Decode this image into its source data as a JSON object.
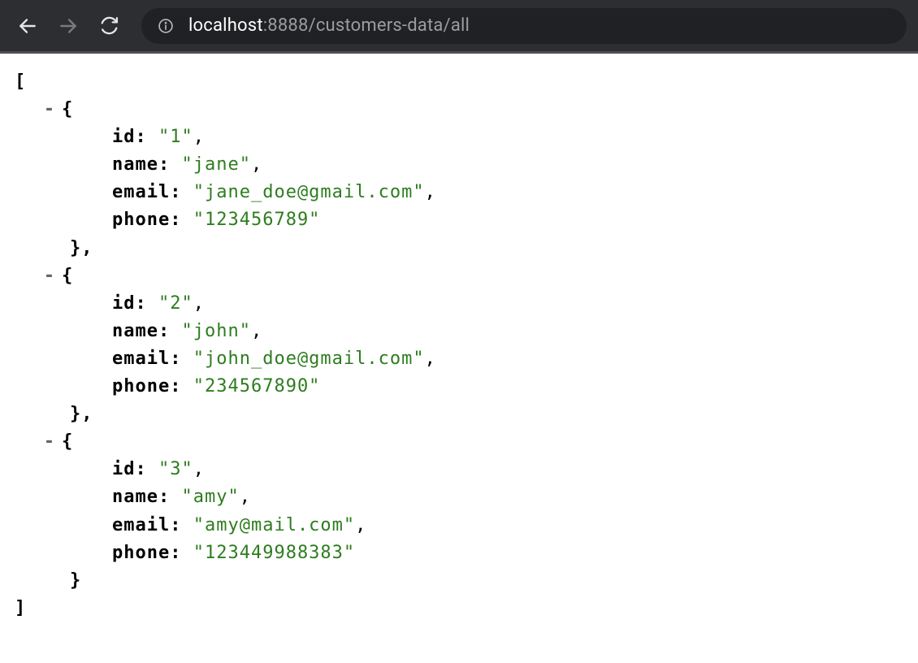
{
  "browser": {
    "url_host": "localhost",
    "url_port": ":8888",
    "url_path": "/customers-data/all"
  },
  "json": {
    "open_bracket": "[",
    "close_bracket": "]",
    "open_brace": "{",
    "close_brace": "}",
    "close_brace_comma": "},",
    "dash": "-",
    "customers": [
      {
        "id_key": "id:",
        "id_val": "\"1\"",
        "name_key": "name:",
        "name_val": "\"jane\"",
        "email_key": "email:",
        "email_val": "\"jane_doe@gmail.com\"",
        "phone_key": "phone:",
        "phone_val": "\"123456789\""
      },
      {
        "id_key": "id:",
        "id_val": "\"2\"",
        "name_key": "name:",
        "name_val": "\"john\"",
        "email_key": "email:",
        "email_val": "\"john_doe@gmail.com\"",
        "phone_key": "phone:",
        "phone_val": "\"234567890\""
      },
      {
        "id_key": "id:",
        "id_val": "\"3\"",
        "name_key": "name:",
        "name_val": "\"amy\"",
        "email_key": "email:",
        "email_val": "\"amy@mail.com\"",
        "phone_key": "phone:",
        "phone_val": "\"123449988383\""
      }
    ]
  }
}
